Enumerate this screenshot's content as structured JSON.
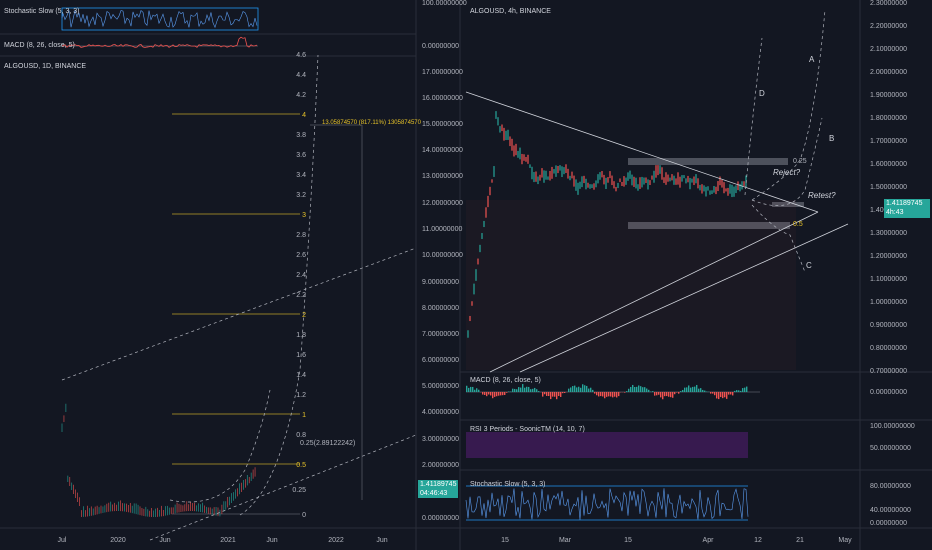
{
  "left": {
    "stoch_title": "Stochastic Slow (5, 3, 3)",
    "macd_title": "MACD (8, 26, close, 5)",
    "symbol": "ALGOUSD, 1D, BINANCE",
    "axis_top": [
      "100.00000000",
      "0.00000000"
    ],
    "price_axis": [
      "17.00000000",
      "16.00000000",
      "15.00000000",
      "14.00000000",
      "13.00000000",
      "12.00000000",
      "11.00000000",
      "10.00000000",
      "9.00000000",
      "8.00000000",
      "7.00000000",
      "6.00000000",
      "5.00000000",
      "4.00000000",
      "3.00000000",
      "2.00000000",
      "0.00000000"
    ],
    "price_label": "1.41189745",
    "countdown": "04:46:43",
    "fib_scale": [
      "4.6",
      "4.4",
      "4.2",
      "4",
      "3.8",
      "3.6",
      "3.4",
      "3.2",
      "3",
      "2.8",
      "2.6",
      "2.4",
      "2.2",
      "2",
      "1.8",
      "1.6",
      "1.4",
      "1.2",
      "1",
      "0.8",
      "0.5",
      "0.25",
      "0"
    ],
    "fib_key": [
      "4",
      "3",
      "2",
      "1",
      "0.5"
    ],
    "fib_note": "0.25(2.89122242)",
    "measure_label": "13.05874570 (817.11%) 1305874570",
    "time_axis": [
      "Jul",
      "2020",
      "Jun",
      "2021",
      "Jun",
      "2022",
      "Jun"
    ]
  },
  "right": {
    "symbol": "ALGOUSD, 4h, BINANCE",
    "price_axis": [
      "2.30000000",
      "2.20000000",
      "2.10000000",
      "2.00000000",
      "1.90000000",
      "1.80000000",
      "1.70000000",
      "1.60000000",
      "1.50000000",
      "1.40000000",
      "1.30000000",
      "1.20000000",
      "1.10000000",
      "1.00000000",
      "0.90000000",
      "0.80000000",
      "0.70000000"
    ],
    "price_label": "1.41189745",
    "countdown": "4h:43",
    "macd_title": "MACD (8, 26, close, 5)",
    "macd_axis": "0.00000000",
    "rsi_title": "RSI 3 Periods - SoonicTM (14, 10, 7)",
    "rsi_axis": [
      "100.00000000",
      "50.00000000"
    ],
    "stoch_title": "Stochastic Slow (5, 3, 3)",
    "stoch_axis": [
      "80.00000000",
      "40.00000000",
      "0.00000000"
    ],
    "time_axis": [
      "15",
      "Mar",
      "15",
      "Apr",
      "12",
      "21",
      "May"
    ],
    "annotations": {
      "reject": "Reject?",
      "retest": "Retest?",
      "fib_025": "0.25",
      "fib_05": "0.5",
      "wave_a": "A",
      "wave_b": "B",
      "wave_c": "C",
      "wave_d": "D"
    }
  },
  "colors": {
    "background": "#131722",
    "up": "#26a69a",
    "down": "#ef5350",
    "fib_line": "#e6c229",
    "price_tag": "#26a69a",
    "rsi_band": "#7b1fa2",
    "stoch_line": "#2196f3"
  }
}
